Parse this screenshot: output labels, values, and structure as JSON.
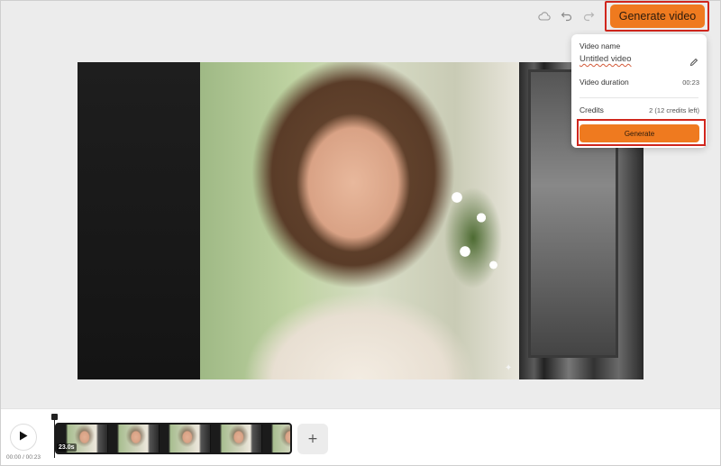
{
  "toolbar": {
    "icons": [
      "cloud-icon",
      "undo-icon",
      "redo-icon"
    ],
    "generate_video_label": "Generate video",
    "accent_color": "#ef7a1f"
  },
  "popup": {
    "video_name_label": "Video name",
    "video_name_value": "Untitled video",
    "video_duration_label": "Video duration",
    "video_duration_value": "00:23",
    "credits_label": "Credits",
    "credits_value": "2 (12 credits left)",
    "generate_label": "Generate"
  },
  "timeline": {
    "time_readout": "00:00 / 00:23",
    "clip_duration": "23.0s",
    "add_label": "+"
  }
}
